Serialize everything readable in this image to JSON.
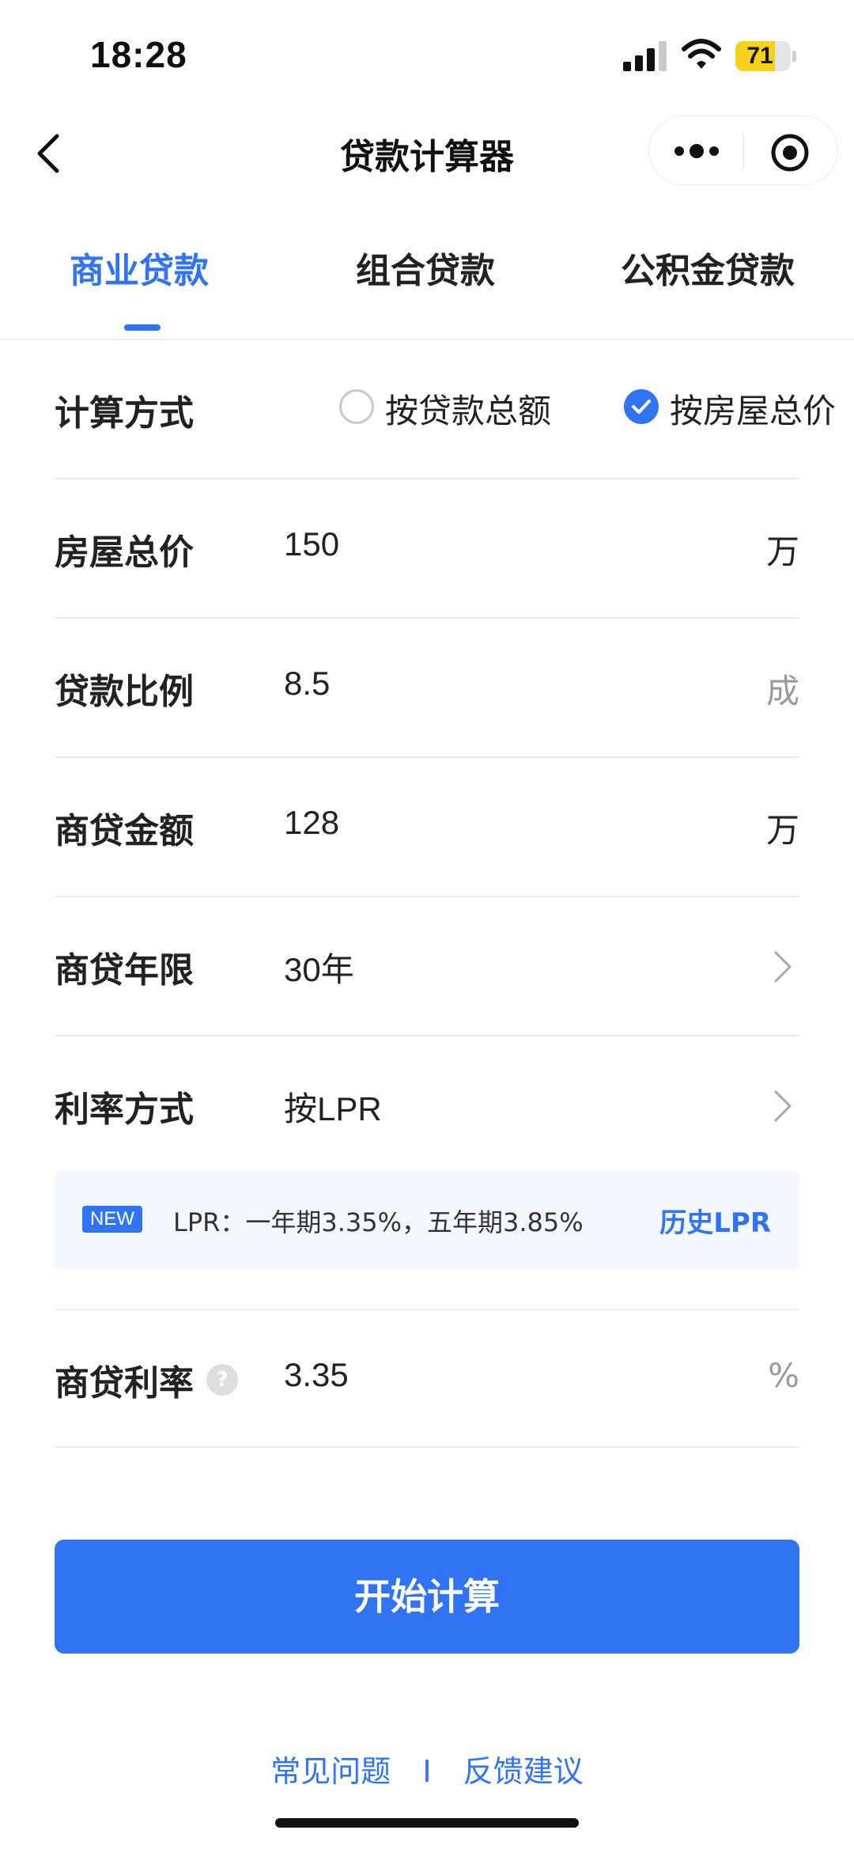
{
  "status_bar": {
    "time": "18:28",
    "battery_level": "71",
    "battery_fraction": 0.71
  },
  "nav": {
    "title": "贷款计算器"
  },
  "tabs": [
    {
      "label": "商业贷款",
      "active": true
    },
    {
      "label": "组合贷款",
      "active": false
    },
    {
      "label": "公积金贷款",
      "active": false
    }
  ],
  "form": {
    "calc_method": {
      "label": "计算方式",
      "options": [
        {
          "label": "按贷款总额",
          "checked": false
        },
        {
          "label": "按房屋总价",
          "checked": true
        }
      ]
    },
    "house_price": {
      "label": "房屋总价",
      "value": "150",
      "unit": "万"
    },
    "loan_ratio": {
      "label": "贷款比例",
      "value": "8.5",
      "unit": "成"
    },
    "loan_amount": {
      "label": "商贷金额",
      "value": "128",
      "unit": "万"
    },
    "loan_term": {
      "label": "商贷年限",
      "value": "30年"
    },
    "rate_method": {
      "label": "利率方式",
      "value": "按LPR"
    },
    "lpr_banner": {
      "badge": "NEW",
      "text": "LPR：一年期3.35%，五年期3.85%",
      "link": "历史LPR"
    },
    "loan_rate": {
      "label": "商贷利率",
      "help": "?",
      "value": "3.35",
      "unit": "%"
    }
  },
  "actions": {
    "calculate": "开始计算"
  },
  "footer": {
    "faq": "常见问题",
    "separator": "I",
    "feedback": "反馈建议"
  },
  "colors": {
    "accent": "#3174f3",
    "battery": "#f6d21a"
  }
}
